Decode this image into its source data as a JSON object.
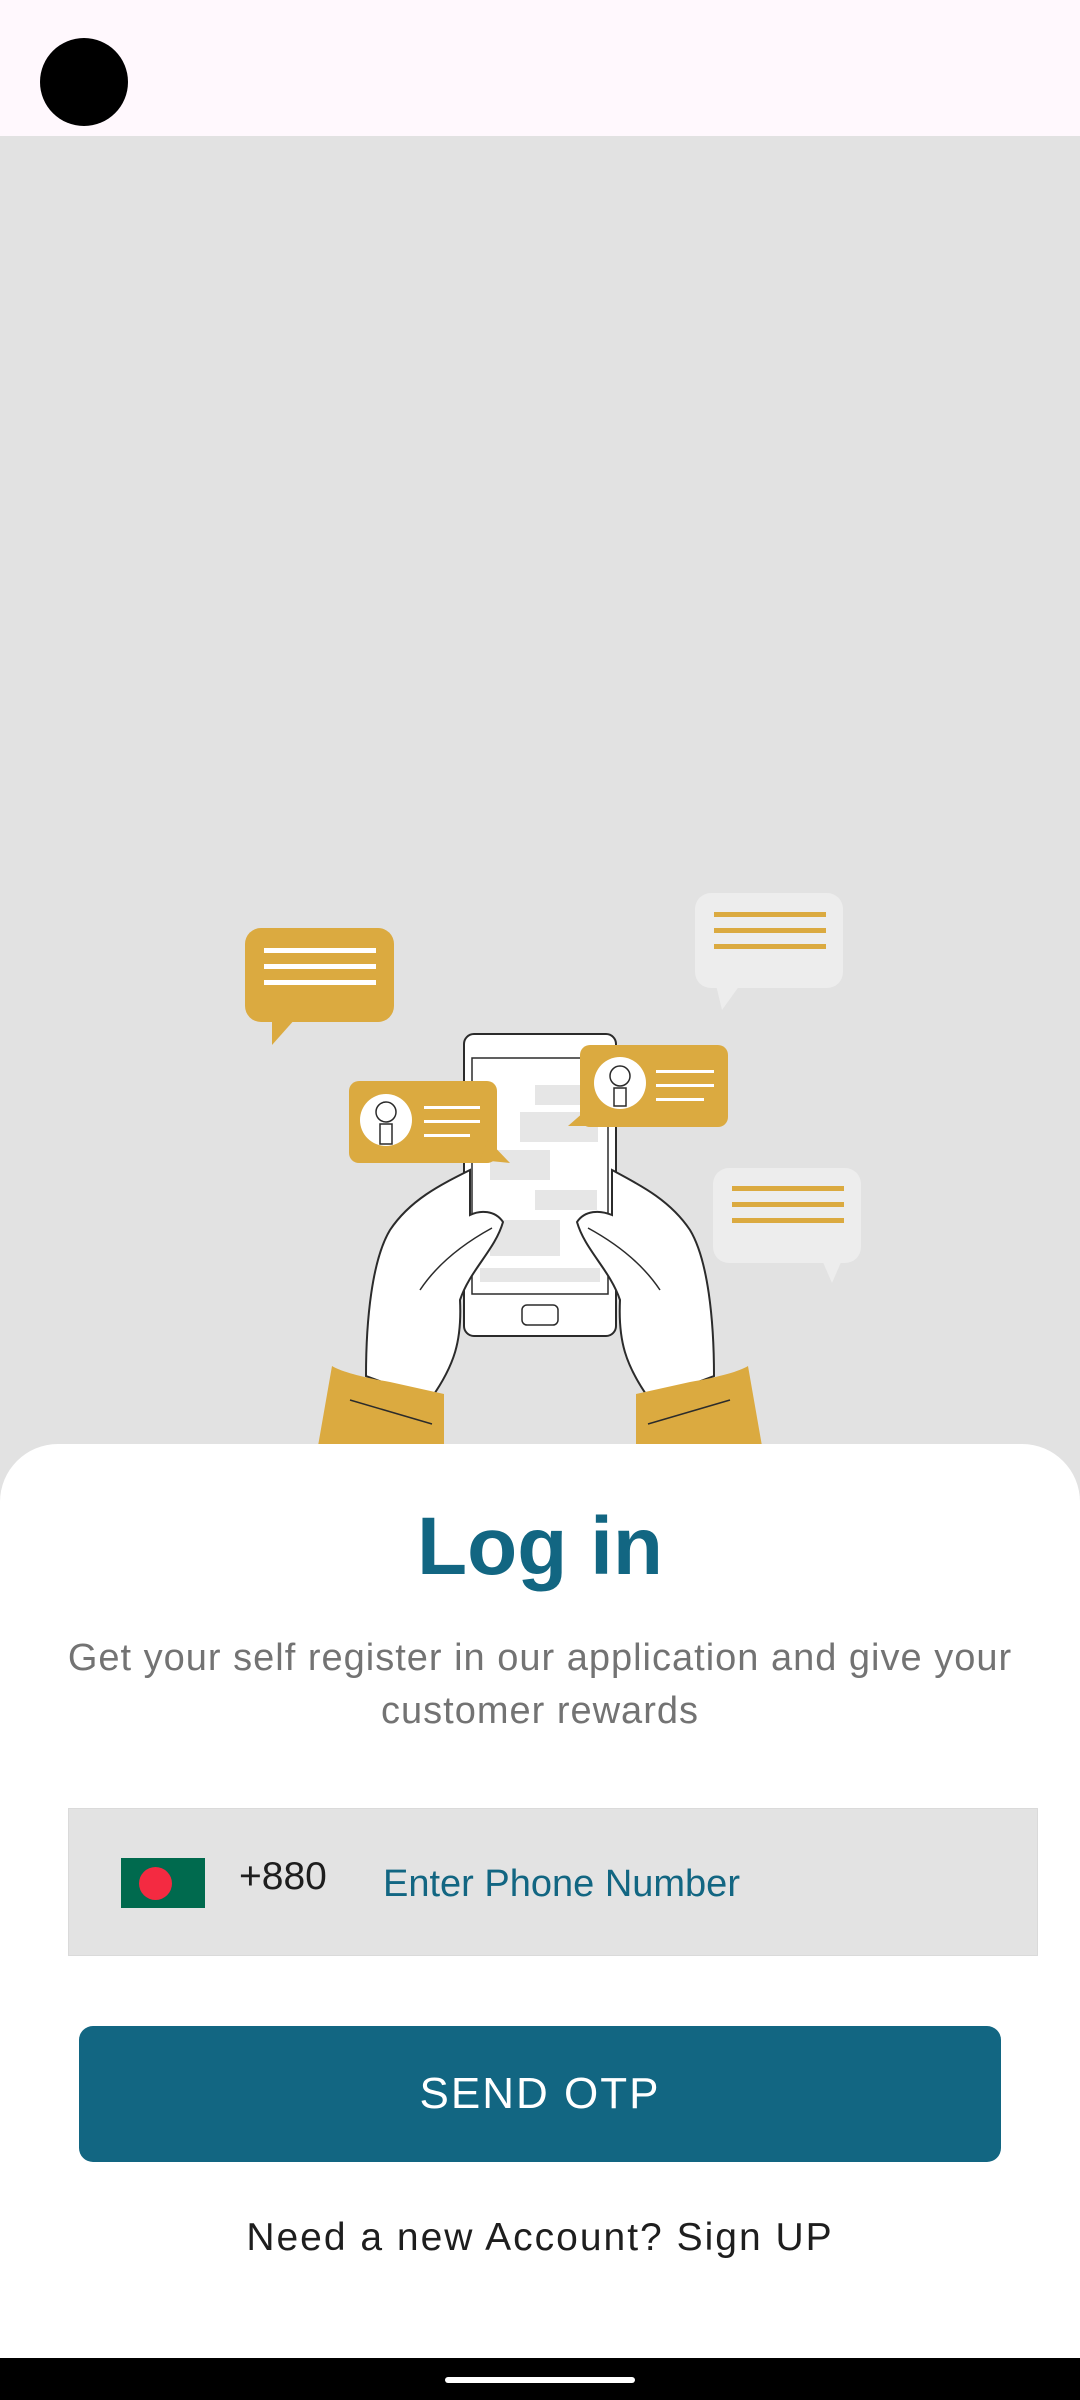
{
  "login": {
    "title": "Log in",
    "subtitle": "Get your self register in our application and give your customer rewards",
    "country_code": "+880",
    "phone_placeholder": "Enter Phone Number",
    "send_otp_label": "SEND OTP",
    "signup_prompt": "Need a new Account?",
    "signup_link": "Sign UP"
  },
  "icons": {
    "flag": "bangladesh-flag-icon",
    "illustration": "phone-chat-illustration"
  },
  "colors": {
    "primary": "#126682",
    "accent": "#dbaa40",
    "background": "#e2e2e2",
    "sheet": "#ffffff"
  }
}
